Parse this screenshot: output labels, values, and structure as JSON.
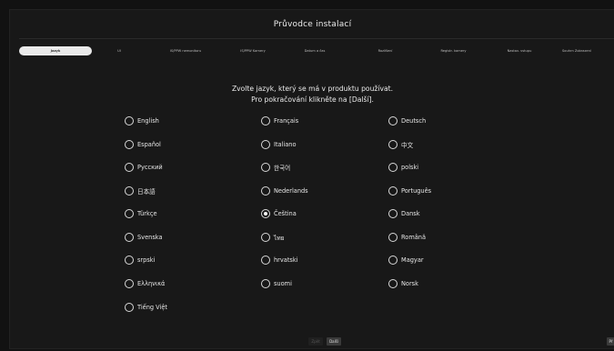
{
  "header": {
    "title": "Průvodce instalací"
  },
  "tabs": [
    {
      "label": "Jazyk",
      "active": true
    },
    {
      "label": "UI",
      "active": false
    },
    {
      "label": "IS/PPW nemonitoru",
      "active": false
    },
    {
      "label": "IS/PPW Kamery",
      "active": false
    },
    {
      "label": "Datum a čas",
      "active": false
    },
    {
      "label": "Rozlišení",
      "active": false
    },
    {
      "label": "Registr. kamery",
      "active": false
    },
    {
      "label": "Nastav. vstupu",
      "active": false
    },
    {
      "label": "Souhrn Zobrazení",
      "active": false
    }
  ],
  "instructions": {
    "line1": "Zvolte jazyk, který se má v produktu používat.",
    "line2": "Pro pokračování klikněte na [Další]."
  },
  "languages": [
    {
      "label": "English",
      "checked": false
    },
    {
      "label": "Français",
      "checked": false
    },
    {
      "label": "Deutsch",
      "checked": false
    },
    {
      "label": "Español",
      "checked": false
    },
    {
      "label": "Italiano",
      "checked": false
    },
    {
      "label": "中文",
      "checked": false
    },
    {
      "label": "Русский",
      "checked": false
    },
    {
      "label": "한국어",
      "checked": false
    },
    {
      "label": "polski",
      "checked": false
    },
    {
      "label": "日本語",
      "checked": false
    },
    {
      "label": "Nederlands",
      "checked": false
    },
    {
      "label": "Português",
      "checked": false
    },
    {
      "label": "Türkçe",
      "checked": false
    },
    {
      "label": "Čeština",
      "checked": true
    },
    {
      "label": "Dansk",
      "checked": false
    },
    {
      "label": "Svenska",
      "checked": false
    },
    {
      "label": "ไทย",
      "checked": false
    },
    {
      "label": "Română",
      "checked": false
    },
    {
      "label": "srpski",
      "checked": false
    },
    {
      "label": "hrvatski",
      "checked": false
    },
    {
      "label": "Magyar",
      "checked": false
    },
    {
      "label": "Ελληνικά",
      "checked": false
    },
    {
      "label": "suomi",
      "checked": false
    },
    {
      "label": "Norsk",
      "checked": false
    },
    {
      "label": "Tiếng Việt",
      "checked": false
    }
  ],
  "footer": {
    "prev_label": "Zpět",
    "next_label": "Další",
    "skip_label": "Př"
  }
}
